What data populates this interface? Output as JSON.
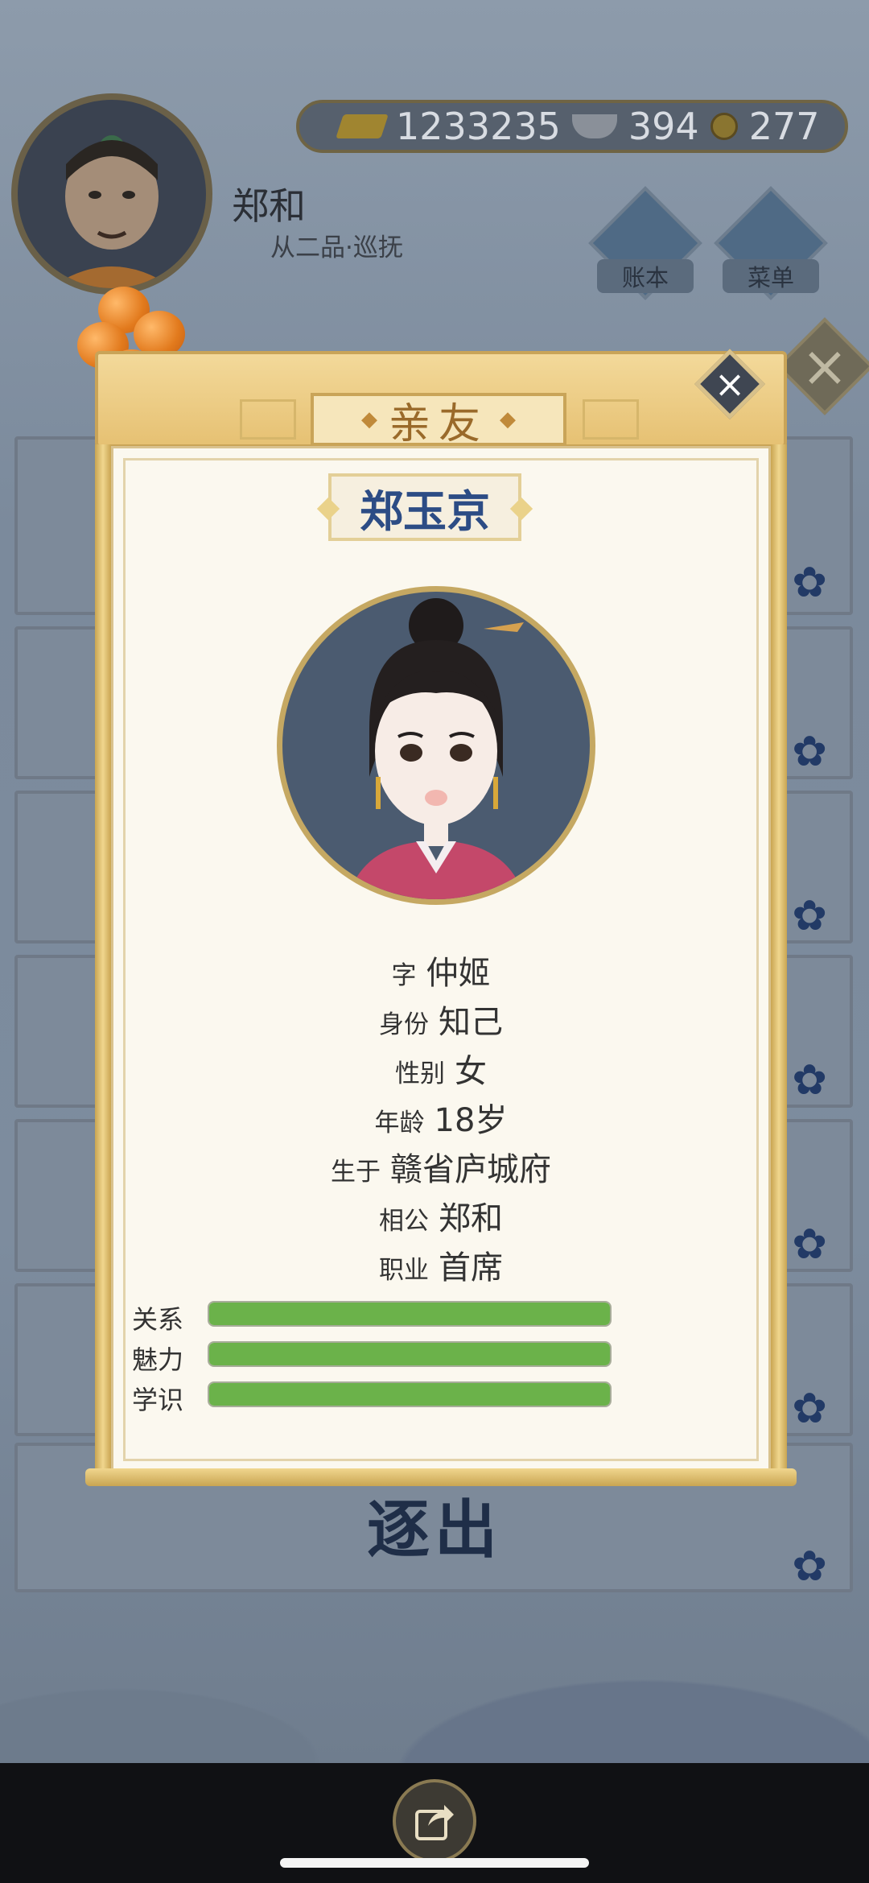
{
  "player": {
    "name": "郑和",
    "rank": "从二品·巡抚"
  },
  "resources": {
    "gold": "1233235",
    "silver": "394",
    "coins": "277"
  },
  "top_buttons": {
    "ledger": "账本",
    "menu": "菜单"
  },
  "background": {
    "expel_label": "逐出"
  },
  "modal": {
    "header_title": "亲友",
    "close_symbol": "×",
    "person_name": "郑玉京",
    "info": [
      {
        "key": "字",
        "value": "仲姬"
      },
      {
        "key": "身份",
        "value": "知己"
      },
      {
        "key": "性别",
        "value": "女"
      },
      {
        "key": "年龄",
        "value": "18岁"
      },
      {
        "key": "生于",
        "value": "赣省庐城府"
      },
      {
        "key": "相公",
        "value": "郑和"
      },
      {
        "key": "职业",
        "value": "首席"
      }
    ],
    "stats": [
      {
        "label": "关系",
        "level": 1.0
      },
      {
        "label": "魅力",
        "level": 1.0
      },
      {
        "label": "学识",
        "level": 1.0
      }
    ]
  },
  "colors": {
    "stat_fill": "#6bb24a",
    "name_color": "#2c4c85",
    "scroll_gold": "#e6c173"
  }
}
